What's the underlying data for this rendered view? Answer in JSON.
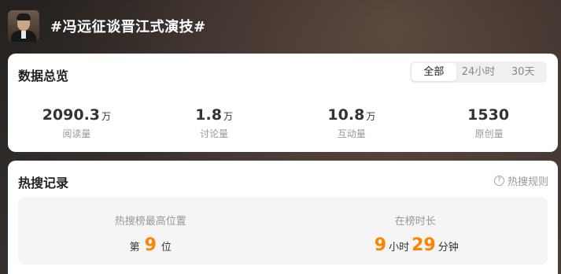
{
  "header": {
    "topic": "#冯远征谈晋江式演技#"
  },
  "overview": {
    "title": "数据总览",
    "tabs": [
      {
        "label": "全部",
        "active": true
      },
      {
        "label": "24小时",
        "active": false
      },
      {
        "label": "30天",
        "active": false
      }
    ],
    "stats": [
      {
        "value": "2090.3",
        "unit": "万",
        "label": "阅读量"
      },
      {
        "value": "1.8",
        "unit": "万",
        "label": "讨论量"
      },
      {
        "value": "10.8",
        "unit": "万",
        "label": "互动量"
      },
      {
        "value": "1530",
        "unit": "",
        "label": "原创量"
      }
    ]
  },
  "hot": {
    "title": "热搜记录",
    "rules_label": "热搜规则",
    "rules_icon": "?",
    "highest": {
      "label": "热搜榜最高位置",
      "prefix": "第",
      "value": "9",
      "suffix": "位"
    },
    "duration": {
      "label": "在榜时长",
      "hours": "9",
      "hours_unit": "小时",
      "minutes": "29",
      "minutes_unit": "分钟"
    }
  },
  "colors": {
    "accent": "#ff8200"
  }
}
